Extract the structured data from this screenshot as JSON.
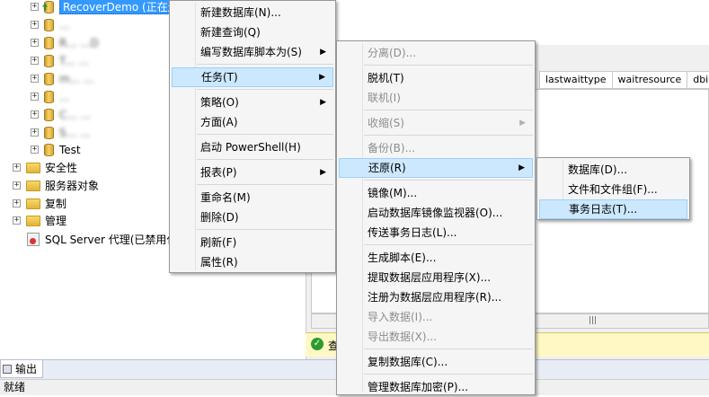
{
  "tree": {
    "selected_db": "RecoverDemo (正在还",
    "blurred_dbs": [
      "...",
      "R... ...D",
      "T... ...",
      "m... ...",
      "...",
      "C... ...",
      "S... ..."
    ],
    "test_db": "Test",
    "folders": [
      "安全性",
      "服务器对象",
      "复制",
      "管理"
    ],
    "agent": "SQL Server 代理(已禁用代"
  },
  "grid": {
    "columns": [
      "lastwaittype",
      "waitresource",
      "dbid"
    ]
  },
  "status_strip": {
    "text": "查"
  },
  "bottom": {
    "output_tab": "输出",
    "status": "就绪"
  },
  "menu1": {
    "items": [
      {
        "label": "新建数据库(N)..."
      },
      {
        "label": "新建查询(Q)"
      },
      {
        "label": "编写数据库脚本为(S)"
      },
      {
        "label": "任务(T)"
      },
      {
        "label": "策略(O)"
      },
      {
        "label": "方面(A)"
      },
      {
        "label": "启动 PowerShell(H)"
      },
      {
        "label": "报表(P)"
      },
      {
        "label": "重命名(M)"
      },
      {
        "label": "删除(D)"
      },
      {
        "label": "刷新(F)"
      },
      {
        "label": "属性(R)"
      }
    ]
  },
  "menu2": {
    "items": [
      {
        "label": "分离(D)..."
      },
      {
        "label": "脱机(T)"
      },
      {
        "label": "联机(I)"
      },
      {
        "label": "收缩(S)"
      },
      {
        "label": "备份(B)..."
      },
      {
        "label": "还原(R)"
      },
      {
        "label": "镜像(M)..."
      },
      {
        "label": "启动数据库镜像监视器(O)..."
      },
      {
        "label": "传送事务日志(L)..."
      },
      {
        "label": "生成脚本(E)..."
      },
      {
        "label": "提取数据层应用程序(X)..."
      },
      {
        "label": "注册为数据层应用程序(R)..."
      },
      {
        "label": "导入数据(I)..."
      },
      {
        "label": "导出数据(X)..."
      },
      {
        "label": "复制数据库(C)..."
      },
      {
        "label": "管理数据库加密(P)..."
      }
    ]
  },
  "menu3": {
    "items": [
      {
        "label": "数据库(D)..."
      },
      {
        "label": "文件和文件组(F)..."
      },
      {
        "label": "事务日志(T)..."
      }
    ]
  }
}
